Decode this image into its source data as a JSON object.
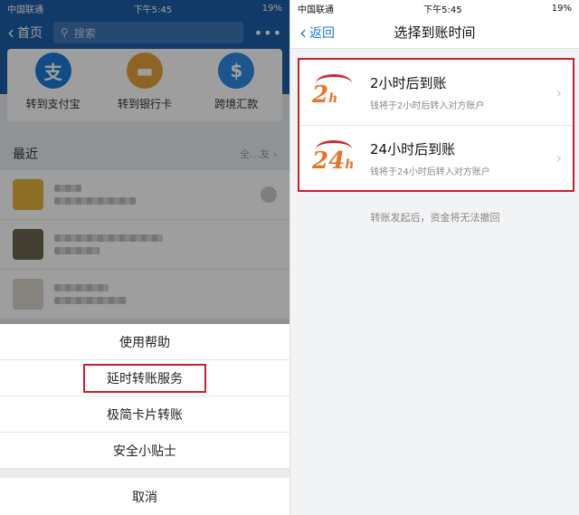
{
  "left": {
    "status": {
      "carrier": "中国联通",
      "time": "下午5:45",
      "battery": "19%"
    },
    "nav": {
      "back_label": "首页",
      "search_placeholder": "搜索",
      "more": "•••"
    },
    "services": [
      {
        "label": "转到支付宝",
        "icon": "alipay-icon",
        "glyph": "支",
        "color": "#1d7bd9"
      },
      {
        "label": "转到银行卡",
        "icon": "bank-card-icon",
        "glyph": "▬",
        "color": "#e6a23c"
      },
      {
        "label": "跨境汇款",
        "icon": "cross-border-icon",
        "glyph": "$",
        "color": "#2f8be6"
      }
    ],
    "recent": {
      "title": "最近",
      "more": "全…友"
    },
    "sheet": {
      "options": [
        "使用帮助",
        "延时转账服务",
        "极简卡片转账",
        "安全小贴士"
      ],
      "cancel": "取消"
    },
    "colors": {
      "brand": "#1d5ea8",
      "highlight": "#c8202a"
    }
  },
  "right": {
    "status": {
      "carrier": "中国联通",
      "time": "下午5:45",
      "battery": "19%"
    },
    "nav": {
      "back_label": "返回",
      "title": "选择到账时间"
    },
    "items": [
      {
        "logo": "2",
        "title": "2小时后到账",
        "subtitle": "钱将于2小时后转入对方账户"
      },
      {
        "logo": "24",
        "title": "24小时后到账",
        "subtitle": "钱将于24小时后转入对方账户"
      }
    ],
    "note": "转账发起后，资金将无法撤回"
  }
}
